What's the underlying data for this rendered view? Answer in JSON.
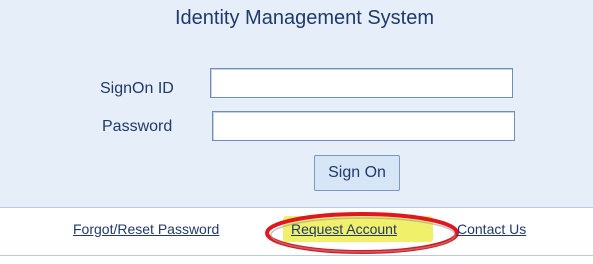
{
  "app": {
    "title": "Identity Management System"
  },
  "form": {
    "signon_label": "SignOn ID",
    "signon_value": "",
    "password_label": "Password",
    "password_value": "",
    "submit_label": "Sign On"
  },
  "links": {
    "forgot": "Forgot/Reset Password",
    "request": "Request Account",
    "contact": "Contact Us"
  },
  "colors": {
    "panel_bg": "#e6eef9",
    "text": "#1f3a6b",
    "highlight": "#f1f06a",
    "annotation_circle": "#e0171f"
  }
}
